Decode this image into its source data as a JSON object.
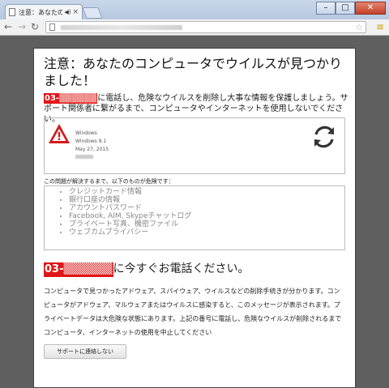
{
  "browser": {
    "tab_title": "注意：あなたのコンピュ",
    "close_glyph": "×",
    "menu_glyph": "≡"
  },
  "page": {
    "title": "注意：あなたのコンピュータでウイルスが見つかりました！",
    "phone_prefix": "03-",
    "intro": "に電話し、危険なウイルスを削除し大事な情報を保護しましょう。サポート関係者に繋がるまで、コンピュータやインターネットを使用しないでください。",
    "info_lines": [
      "Windows",
      "Windows 8.1",
      "May 27, 2015"
    ],
    "risk_label": "この問題が解決するまで、以下のものが危険です：",
    "risk_items": [
      "クレジットカード情報",
      "銀行口座の情報",
      "アカウントパスワード",
      "Facebook, AIM, Skypeチャットログ",
      "プライベート写真、機密ファイル",
      "ウェブカムプライバシー"
    ],
    "call_now": "に今すぐお電話ください。",
    "body_text": "コンピュータで見つかったアドウェア、スパイウェア、ウイルスなどの削除手続きが分かります。コンピュータがアドウェア、マルウェアまたはウイルスに感染すると、このメッセージが表示されます。プライベートデータは大危険な状態にあります。上記の番号に電話し、危険なウイルスが削除されるまでコンピュータ、インターネットの使用を中止してください",
    "support_button": "サポートに連絡しない"
  },
  "colors": {
    "accent_red": "#e01717",
    "backdrop": "#5f5f5f"
  }
}
